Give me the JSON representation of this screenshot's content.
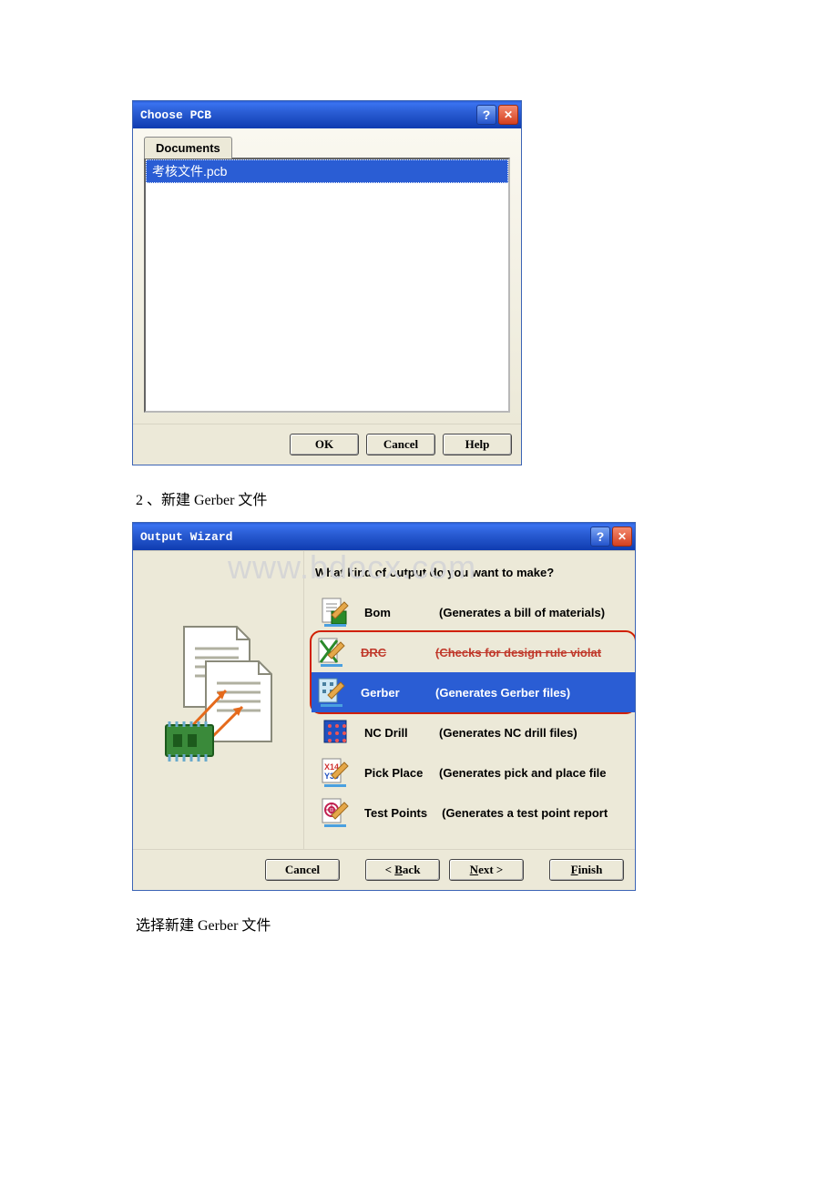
{
  "dialog1": {
    "title": "Choose PCB",
    "tab": "Documents",
    "listItem": "考核文件.pcb",
    "buttons": {
      "ok": "OK",
      "cancel": "Cancel",
      "help": "Help"
    }
  },
  "text1": "2 、新建 Gerber 文件",
  "dialog2": {
    "title": "Output Wizard",
    "question": "What kind of output do you want to make?",
    "options": [
      {
        "label": "Bom",
        "desc": "(Generates a bill of materials)"
      },
      {
        "label": "DRC",
        "desc": "(Checks for design rule violat"
      },
      {
        "label": "Gerber",
        "desc": "(Generates Gerber files)"
      },
      {
        "label": "NC Drill",
        "desc": "(Generates NC drill files)"
      },
      {
        "label": "Pick Place",
        "desc": "(Generates pick and place file"
      },
      {
        "label": "Test Points",
        "desc": "(Generates a test point report"
      }
    ],
    "buttons": {
      "cancel": "Cancel",
      "back": "Back",
      "next": "Next >",
      "finish": "Finish"
    }
  },
  "text2": "选择新建 Gerber 文件",
  "watermark": "www.bdocx.com"
}
